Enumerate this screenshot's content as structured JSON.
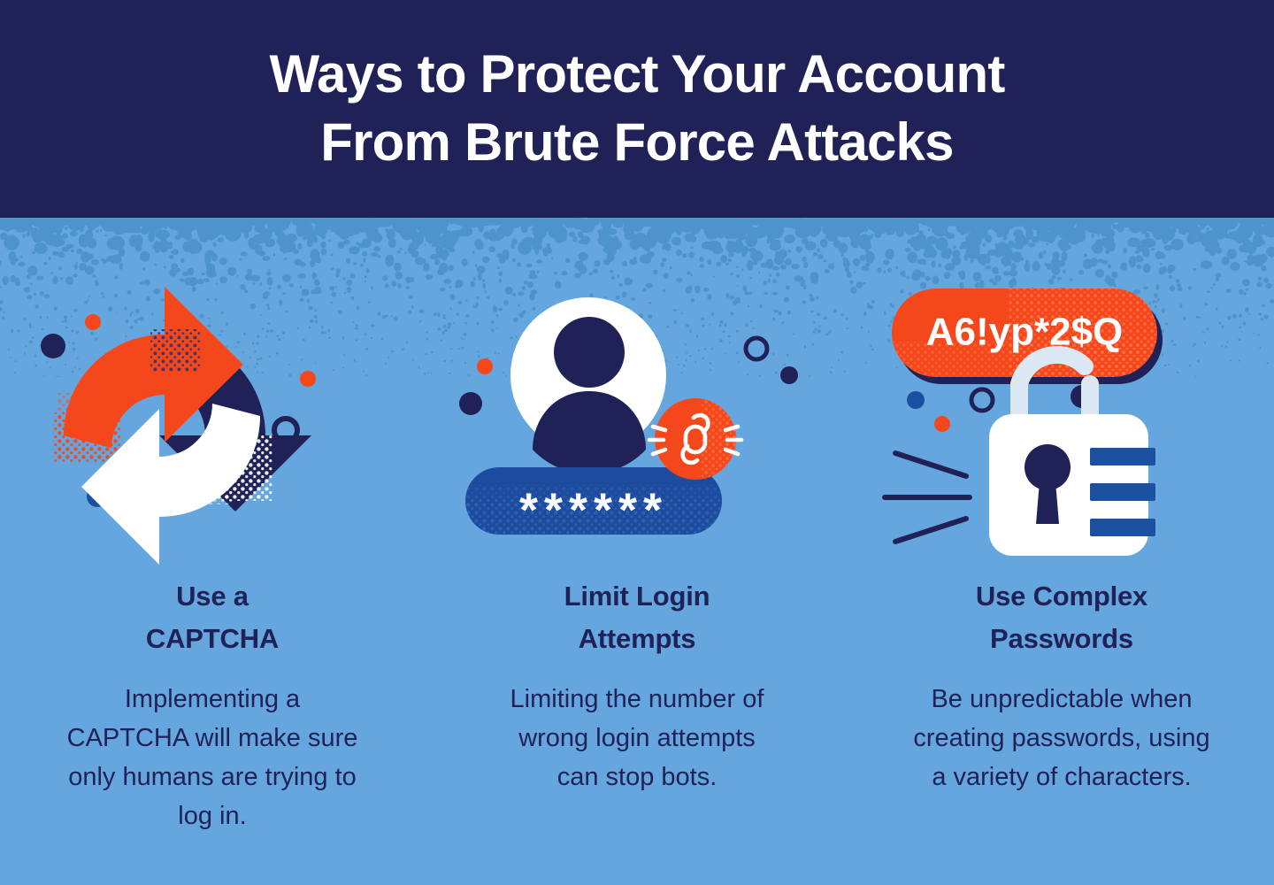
{
  "header": {
    "title_line_1": "Ways to Protect Your Account",
    "title_line_2": "From Brute Force Attacks",
    "background_color": "#1F2157",
    "text_color": "#FFFFFF"
  },
  "theme": {
    "page_background": "#64A6DD",
    "navy": "#1F2157",
    "orange": "#F4481C",
    "white": "#FFFFFF",
    "mid_blue": "#1D4C9E",
    "pale_blue": "#DCE8F3"
  },
  "cards": [
    {
      "id": "captcha",
      "icon_name": "captcha-refresh-arrows-icon",
      "heading_line_1": "Use a",
      "heading_line_2": "CAPTCHA",
      "body": "Implementing a CAPTCHA will make sure only humans are trying to log in."
    },
    {
      "id": "limit-login",
      "icon_name": "user-password-broken-link-icon",
      "heading_line_1": "Limit Login",
      "heading_line_2": "Attempts",
      "body": "Limiting the number of wrong login attempts can stop bots.",
      "password_mask": "******"
    },
    {
      "id": "complex-passwords",
      "icon_name": "padlock-password-pill-icon",
      "heading_line_1": "Use Complex",
      "heading_line_2": "Passwords",
      "body": "Be unpredictable when creating passwords, using a variety of characters.",
      "password_example": "A6!yp*2$Q"
    }
  ]
}
